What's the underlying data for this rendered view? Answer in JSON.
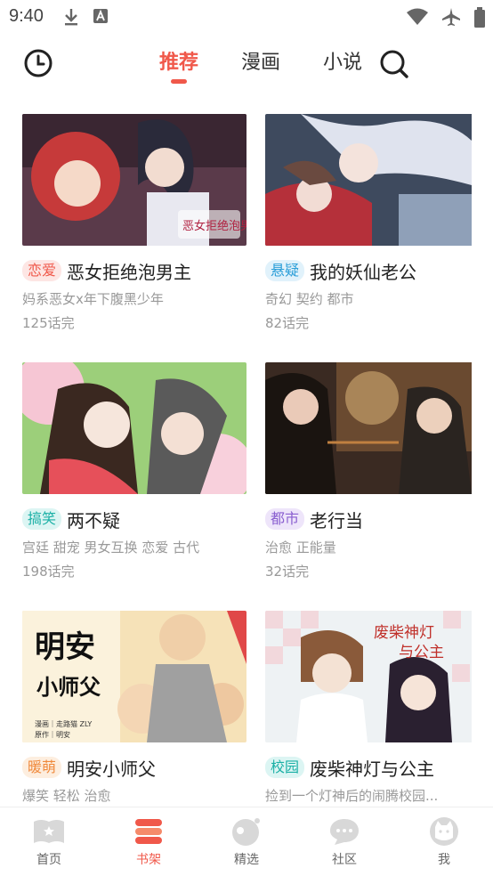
{
  "status_bar": {
    "time": "9:40",
    "left_icons": [
      "download-icon",
      "font-a-icon"
    ],
    "right_icons": [
      "wifi-icon",
      "airplane-icon",
      "battery-icon"
    ]
  },
  "top_nav": {
    "history_icon": "clock-icon",
    "tabs": [
      {
        "label": "推荐",
        "active": true
      },
      {
        "label": "漫画",
        "active": false
      },
      {
        "label": "小说",
        "active": false
      }
    ],
    "search_icon": "search-icon"
  },
  "colors": {
    "accent": "#f0584a"
  },
  "comics": [
    {
      "tag": "恋爱",
      "tag_color": "#f0584a",
      "tag_bg": "#fde6e4",
      "title": "恶女拒绝泡男主",
      "desc": "妈系恶女x年下腹黑少年",
      "episodes": "125话完",
      "cover_text": "恶女拒绝泡男主"
    },
    {
      "tag": "悬疑",
      "tag_color": "#2b9ed8",
      "tag_bg": "#e1f2fb",
      "title": "我的妖仙老公",
      "desc": "奇幻 契约 都市",
      "episodes": "82话完"
    },
    {
      "tag": "搞笑",
      "tag_color": "#1bb0a6",
      "tag_bg": "#dcf5f3",
      "title": "两不疑",
      "desc": "宫廷 甜宠 男女互换 恋爱 古代",
      "episodes": "198话完"
    },
    {
      "tag": "都市",
      "tag_color": "#8a5fd0",
      "tag_bg": "#eee5fa",
      "title": "老行当",
      "desc": "治愈 正能量",
      "episodes": "32话完"
    },
    {
      "tag": "暖萌",
      "tag_color": "#f08a3c",
      "tag_bg": "#fdeedf",
      "title": "明安小师父",
      "desc": "爆笑 轻松 治愈",
      "episodes": "",
      "cover_text": "明安",
      "cover_subtext": "小师父",
      "cover_credit1": "漫画｜走路猫 ZLY",
      "cover_credit2": "原作｜明安"
    },
    {
      "tag": "校园",
      "tag_color": "#1bb0a6",
      "tag_bg": "#dcf5f3",
      "title": "废柴神灯与公主",
      "desc": "捡到一个灯神后的闹腾校园...",
      "episodes": "",
      "cover_text": "废柴神灯",
      "cover_subtext": "与公主"
    }
  ],
  "bottom_nav": [
    {
      "label": "首页",
      "icon": "home-book-icon",
      "active": false
    },
    {
      "label": "书架",
      "icon": "bookshelf-icon",
      "active": true
    },
    {
      "label": "精选",
      "icon": "featured-planet-icon",
      "active": false
    },
    {
      "label": "社区",
      "icon": "community-chat-icon",
      "active": false
    },
    {
      "label": "我",
      "icon": "profile-cat-icon",
      "active": false
    }
  ]
}
